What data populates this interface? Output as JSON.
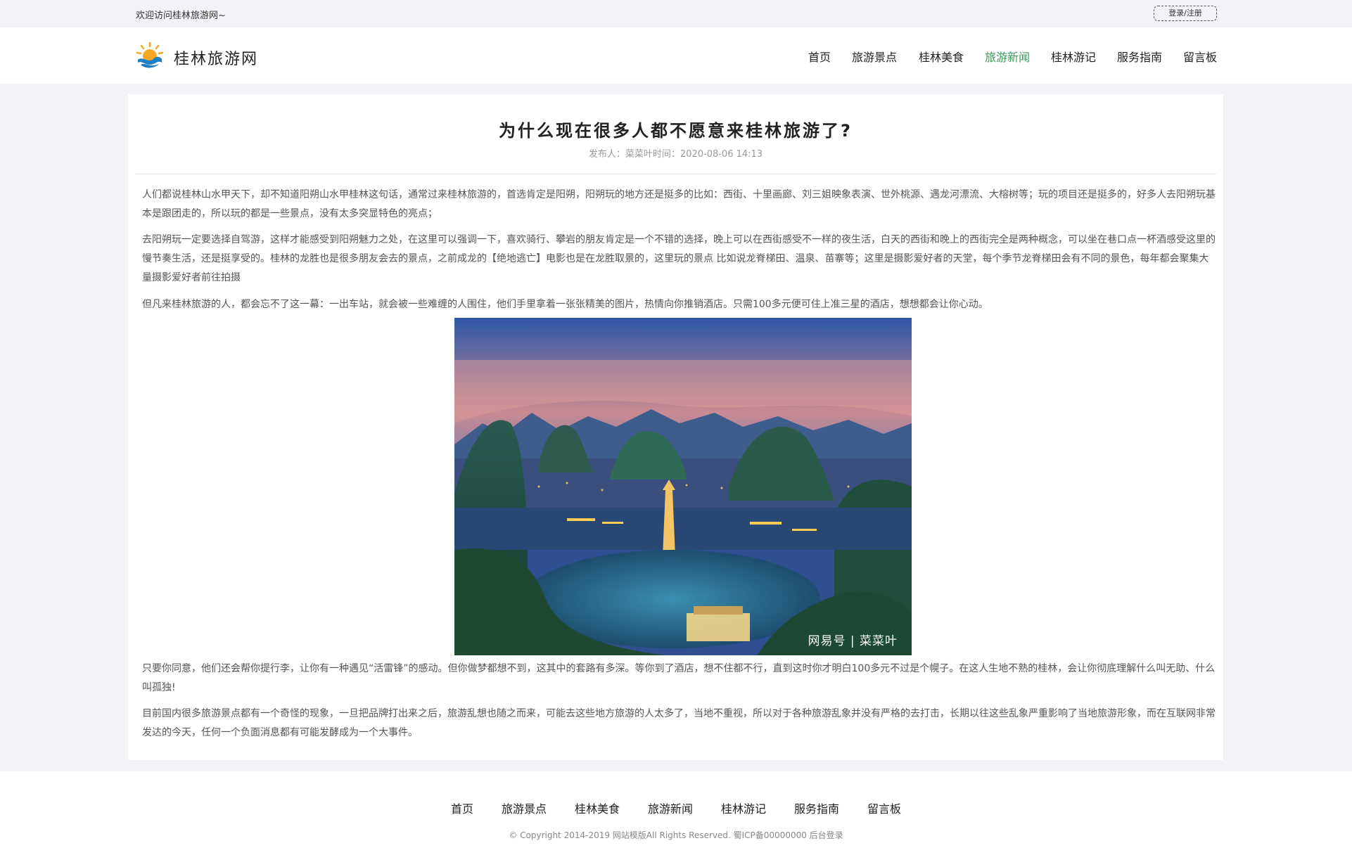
{
  "topbar": {
    "welcome": "欢迎访问桂林旅游网~",
    "login_label": "登录/注册"
  },
  "header": {
    "logo_text": "桂林旅游网"
  },
  "nav": {
    "items": [
      "首页",
      "旅游景点",
      "桂林美食",
      "旅游新闻",
      "桂林游记",
      "服务指南",
      "留言板"
    ],
    "active": "旅游新闻"
  },
  "article": {
    "title": "为什么现在很多人都不愿意来桂林旅游了?",
    "meta": "发布人：菜菜叶时间：2020-08-06 14:13",
    "paragraphs": [
      "人们都说桂林山水甲天下，却不知道阳朔山水甲桂林这句话，通常过来桂林旅游的，首选肯定是阳朔，阳朔玩的地方还是挺多的比如：西街、十里画廊、刘三姐映象表演、世外桃源、遇龙河漂流、大榕树等；玩的项目还是挺多的，好多人去阳朔玩基本是跟团走的，所以玩的都是一些景点，没有太多突显特色的亮点；",
      "去阳朔玩一定要选择自驾游，这样才能感受到阳朔魅力之处，在这里可以强调一下，喜欢骑行、攀岩的朋友肯定是一个不错的选择，晚上可以在西街感受不一样的夜生活，白天的西街和晚上的西街完全是两种概念，可以坐在巷口点一杯酒感受这里的慢节奏生活，还是挺享受的。桂林的龙胜也是很多朋友会去的景点，之前成龙的【绝地逃亡】电影也是在龙胜取景的，这里玩的景点 比如说龙脊梯田、温泉、苗寨等；这里是摄影爱好者的天堂，每个季节龙脊梯田会有不同的景色，每年都会聚集大量摄影爱好者前往拍摄",
      "但凡来桂林旅游的人，都会忘不了这一幕：一出车站，就会被一些难缠的人围住，他们手里拿着一张张精美的图片，热情向你推销酒店。只需100多元便可住上准三星的酒店，想想都会让你心动。",
      "只要你同意，他们还会帮你提行李，让你有一种遇见“活雷锋”的感动。但你做梦都想不到，这其中的套路有多深。等你到了酒店，想不住都不行，直到这时你才明白100多元不过是个幌子。在这人生地不熟的桂林，会让你彻底理解什么叫无助、什么叫孤独!",
      "目前国内很多旅游景点都有一个奇怪的现象，一旦把品牌打出来之后，旅游乱想也随之而来，可能去这些地方旅游的人太多了，当地不重视，所以对于各种旅游乱象并没有严格的去打击，长期以往这些乱象严重影响了当地旅游形象，而在互联网非常发达的今天，任何一个负面消息都有可能发酵成为一个大事件。"
    ],
    "image_watermark": "网易号 | 菜菜叶"
  },
  "footer": {
    "nav": [
      "首页",
      "旅游景点",
      "桂林美食",
      "旅游新闻",
      "桂林游记",
      "服务指南",
      "留言板"
    ],
    "copyright": "© Copyright 2014-2019 网站模版All Rights Reserved. 蜀ICP备00000000 后台登录"
  },
  "colors": {
    "accent": "#3a9a5b",
    "background": "#f1f3f7",
    "logo_orange": "#f5a623",
    "logo_blue": "#1d7fc4"
  },
  "icons": {
    "logo": "sun-wave-logo-icon"
  }
}
